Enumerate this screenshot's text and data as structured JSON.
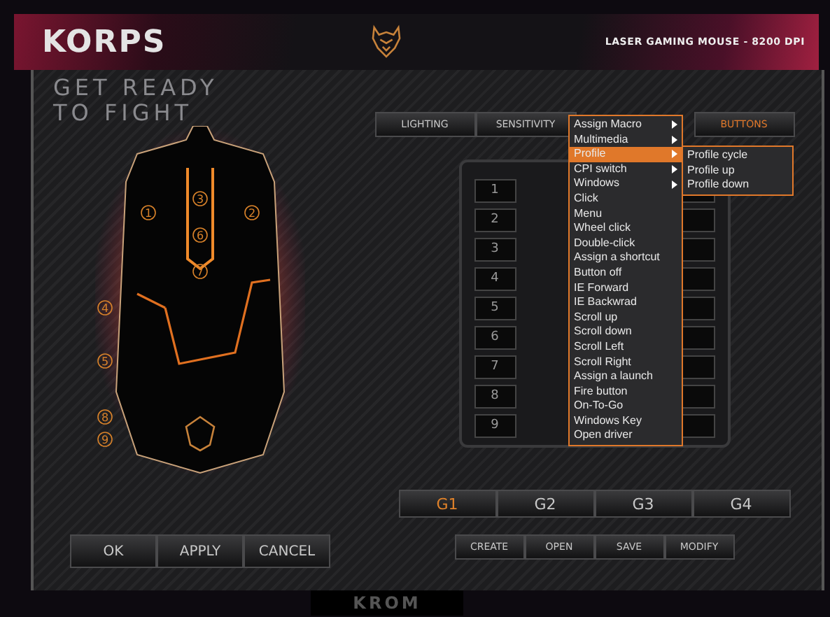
{
  "header": {
    "logo": "KORPS",
    "subtitle": "LASER GAMING MOUSE - 8200 DPI"
  },
  "slogan": [
    "GET READY",
    "TO FIGHT"
  ],
  "mouse": {
    "markers": [
      "1",
      "2",
      "3",
      "6",
      "7",
      "4",
      "5",
      "8",
      "9"
    ]
  },
  "tabs": [
    {
      "label": "LIGHTING",
      "selected": false
    },
    {
      "label": "SENSITIVITY",
      "selected": false
    },
    {
      "label": "BUTTONS",
      "selected": true
    }
  ],
  "button_rows": [
    {
      "number": "1"
    },
    {
      "number": "2"
    },
    {
      "number": "3"
    },
    {
      "number": "4"
    },
    {
      "number": "5"
    },
    {
      "number": "6"
    },
    {
      "number": "7"
    },
    {
      "number": "8"
    },
    {
      "number": "9"
    }
  ],
  "context_menu": {
    "items": [
      {
        "label": "Assign Macro",
        "kind": "submenu",
        "selected": false
      },
      {
        "label": "Multimedia",
        "kind": "submenu",
        "selected": false
      },
      {
        "label": "Profile",
        "kind": "submenu",
        "selected": true
      },
      {
        "label": "CPI switch",
        "kind": "submenu",
        "selected": false
      },
      {
        "label": "Windows",
        "kind": "submenu",
        "selected": false
      },
      {
        "label": "Click",
        "kind": "action",
        "selected": false
      },
      {
        "label": "Menu",
        "kind": "action",
        "selected": false
      },
      {
        "label": "Wheel click",
        "kind": "action",
        "selected": false
      },
      {
        "label": "Double-click",
        "kind": "action",
        "selected": false
      },
      {
        "label": "Assign a shortcut",
        "kind": "action",
        "selected": false
      },
      {
        "label": "Button off",
        "kind": "action",
        "selected": false
      },
      {
        "label": "IE Forward",
        "kind": "action",
        "selected": false
      },
      {
        "label": "IE Backwrad",
        "kind": "action",
        "selected": false
      },
      {
        "label": "Scroll up",
        "kind": "action",
        "selected": false
      },
      {
        "label": "Scroll down",
        "kind": "action",
        "selected": false
      },
      {
        "label": "Scroll Left",
        "kind": "action",
        "selected": false
      },
      {
        "label": "Scroll Right",
        "kind": "action",
        "selected": false
      },
      {
        "label": "Assign a launch",
        "kind": "action",
        "selected": false
      },
      {
        "label": "Fire button",
        "kind": "action",
        "selected": false
      },
      {
        "label": "On-To-Go",
        "kind": "action",
        "selected": false
      },
      {
        "label": "Windows Key",
        "kind": "action",
        "selected": false
      },
      {
        "label": "Open driver",
        "kind": "action",
        "selected": false
      }
    ],
    "submenu": [
      "Profile cycle",
      "Profile up",
      "Profile down"
    ]
  },
  "profiles": [
    {
      "label": "G1",
      "selected": true
    },
    {
      "label": "G2",
      "selected": false
    },
    {
      "label": "G3",
      "selected": false
    },
    {
      "label": "G4",
      "selected": false
    }
  ],
  "profile_actions": [
    "CREATE",
    "OPEN",
    "SAVE",
    "MODIFY"
  ],
  "dialog_buttons": [
    "OK",
    "APPLY",
    "CANCEL"
  ],
  "footer": {
    "brand": "KROM"
  }
}
